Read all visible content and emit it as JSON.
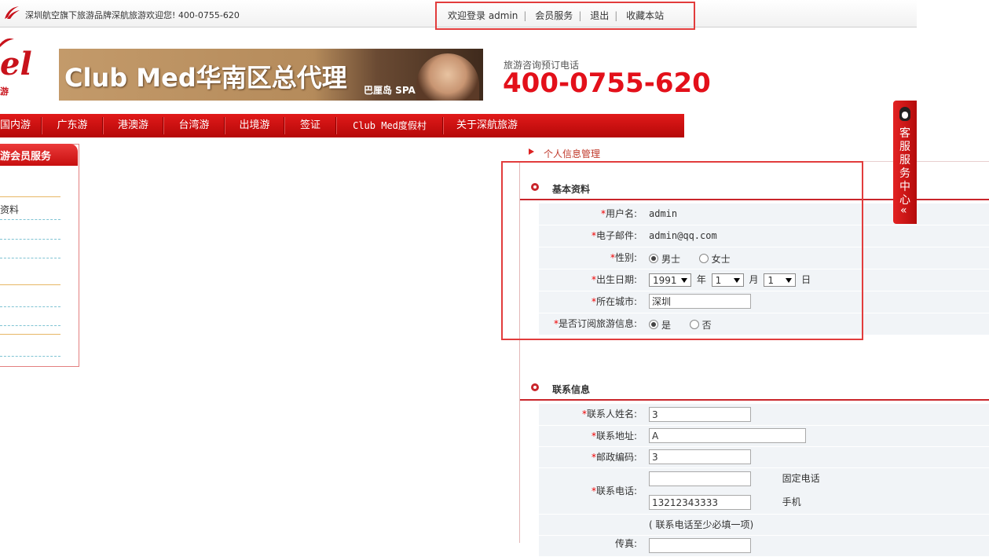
{
  "topbar": {
    "welcome_text": "深圳航空旗下旅游品牌深航旅游欢迎您! 400-0755-620",
    "links": [
      "欢迎登录 admin",
      "会员服务",
      "退出",
      "收藏本站"
    ]
  },
  "logo": {
    "word": "el",
    "sub": "游"
  },
  "banner": {
    "title": "Club Med华南区总代理",
    "caption": "巴厘岛 SPA"
  },
  "phone": {
    "label": "旅游咨询预订电话",
    "number": "400-0755-620"
  },
  "nav": {
    "items": [
      "国内游",
      "广东游",
      "港澳游",
      "台湾游",
      "出境游",
      "签证",
      "Club Med度假村",
      "关于深航旅游"
    ]
  },
  "sidebar": {
    "header": "游会员服务",
    "item": "资料"
  },
  "crumb": "个人信息管理",
  "basic": {
    "title": "基本资料",
    "username_label": "用户名:",
    "username": "admin",
    "email_label": "电子邮件:",
    "email": "admin@qq.com",
    "gender_label": "性别:",
    "gender_male": "男士",
    "gender_female": "女士",
    "birth_label": "出生日期:",
    "birth_year": "1991",
    "year_unit": "年",
    "birth_month": "1",
    "month_unit": "月",
    "birth_day": "1",
    "day_unit": "日",
    "city_label": "所在城市:",
    "city": "深圳",
    "subscribe_label": "是否订阅旅游信息:",
    "subscribe_yes": "是",
    "subscribe_no": "否",
    "required_mark": "*"
  },
  "contact": {
    "title": "联系信息",
    "name_label": "联系人姓名:",
    "name": "3",
    "address_label": "联系地址:",
    "address": "A",
    "zip_label": "邮政编码:",
    "zip": "3",
    "phone_label": "联系电话:",
    "landline": "",
    "landline_label": "固定电话",
    "mobile": "13212343333",
    "mobile_label": "手机",
    "phone_note": "( 联系电话至少必填一项)",
    "next_label": "传真:"
  },
  "cs_tab": {
    "text": "客服服务中心"
  },
  "colors": {
    "brand_red": "#c9252b",
    "nav_red": "#d31212",
    "highlight_box": "#e23c3c",
    "phone_red": "#e3101a"
  }
}
